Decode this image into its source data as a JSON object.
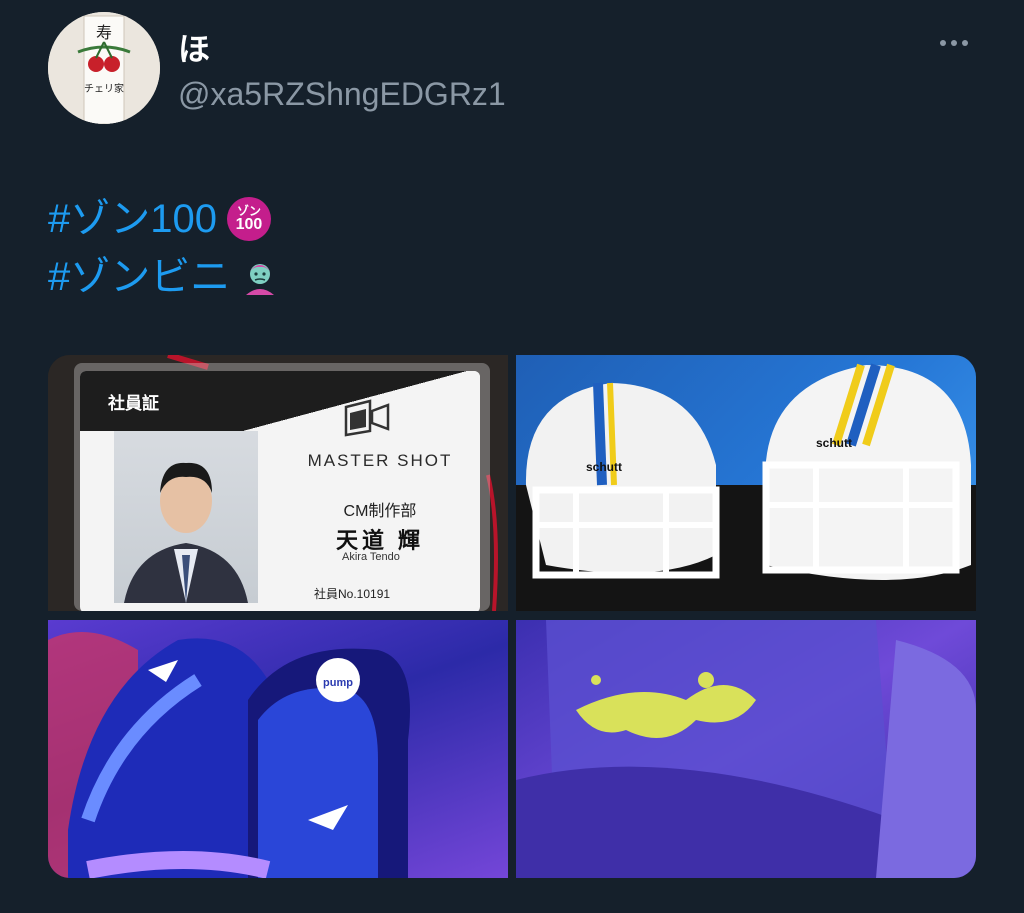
{
  "tweet": {
    "display_name": "ほ",
    "handle": "@xa5RZShngEDGRz1",
    "lines": [
      {
        "hashtag": "#ゾン100",
        "emoji": "zon100-badge-icon",
        "badge_top": "ゾン",
        "badge_bottom": "100"
      },
      {
        "hashtag": "#ゾンビニ",
        "emoji": "zombie-icon"
      }
    ]
  },
  "avatar": {
    "text_top": "寿",
    "text_bottom": "チェリ家"
  },
  "media": {
    "id_card": {
      "title": "社員証",
      "brand": "MASTER SHOT",
      "department": "CM制作部",
      "name": "天道 輝",
      "name_roman": "Akira Tendo",
      "employee_no": "社員No.10191"
    },
    "helmet_brand": "schutt",
    "shoe_brand": "pump"
  },
  "colors": {
    "background": "#15202b",
    "link": "#1d9bf0",
    "secondary_text": "#8b98a5"
  }
}
